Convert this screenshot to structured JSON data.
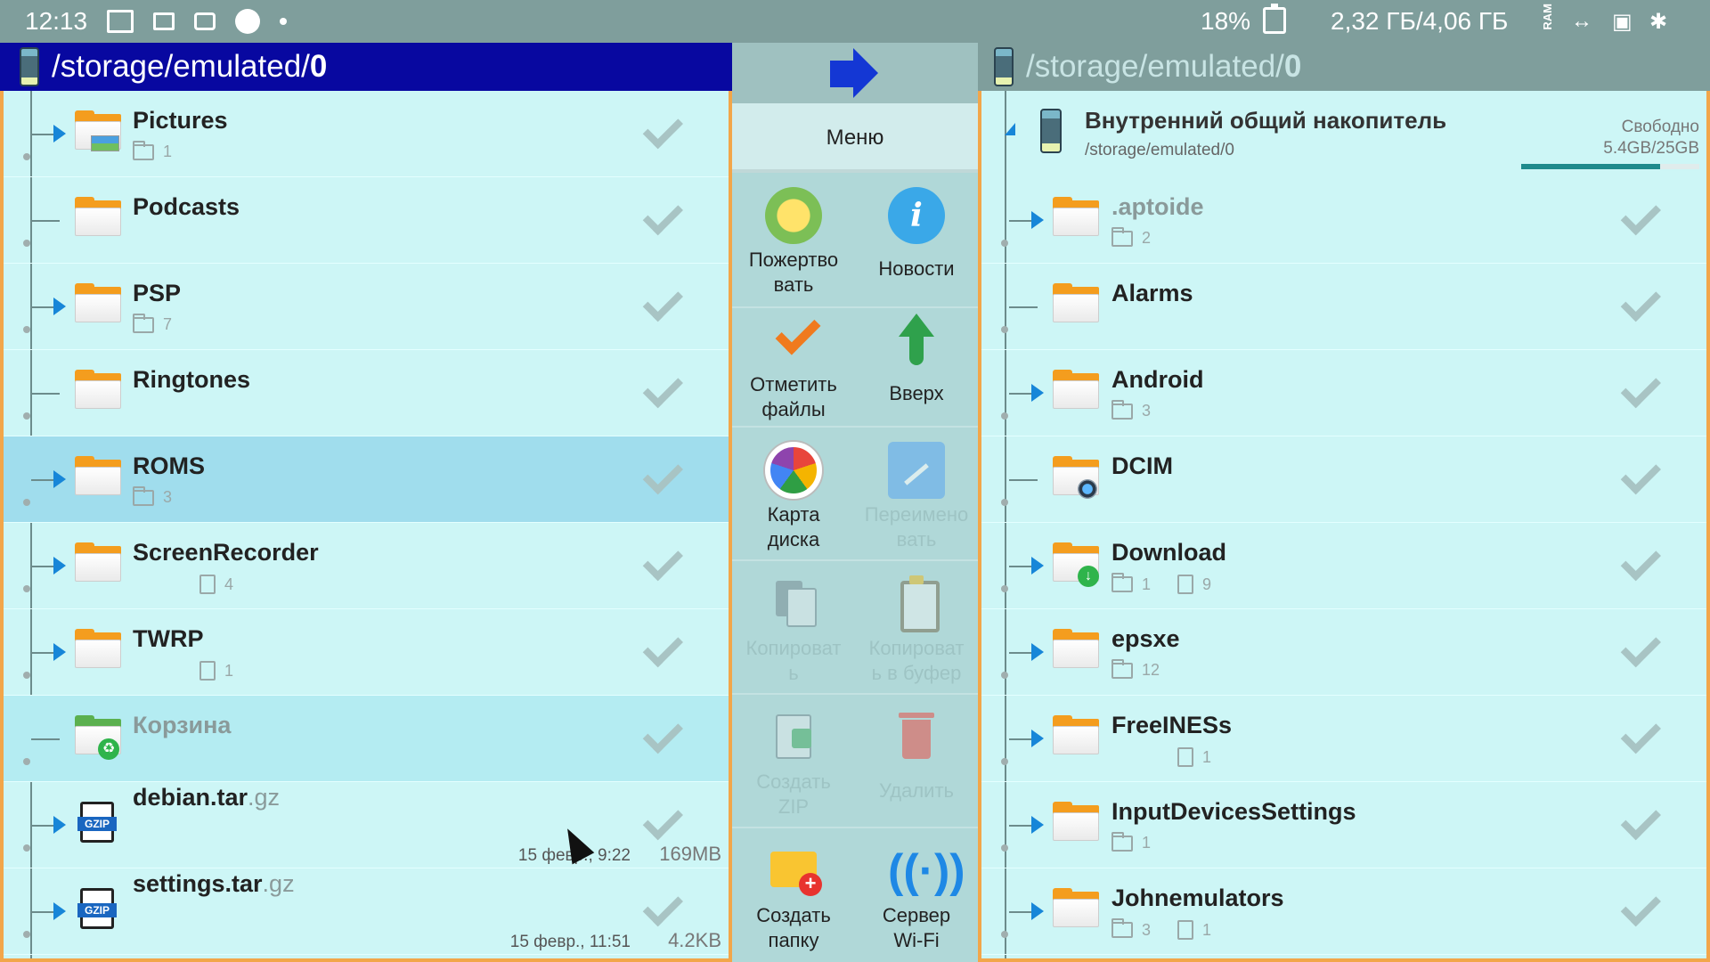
{
  "status_bar": {
    "time": "12:13",
    "battery": "18%",
    "ram": "2,32 ГБ/4,06 ГБ",
    "ram_label": "RAM"
  },
  "left_panel": {
    "path_prefix": "/storage/emulated/",
    "path_last": "0",
    "rows": [
      {
        "name": "Pictures",
        "folders": "1",
        "expandable": true,
        "icon": "folder-pictures-icon"
      },
      {
        "name": "Podcasts",
        "expandable": false,
        "icon": "folder-icon"
      },
      {
        "name": "PSP",
        "folders": "7",
        "expandable": true,
        "icon": "folder-icon"
      },
      {
        "name": "Ringtones",
        "expandable": false,
        "icon": "folder-icon"
      },
      {
        "name": "ROMS",
        "folders": "3",
        "expandable": true,
        "icon": "folder-icon",
        "selected": true
      },
      {
        "name": "ScreenRecorder",
        "files": "4",
        "expandable": true,
        "icon": "folder-icon"
      },
      {
        "name": "TWRP",
        "files": "1",
        "expandable": true,
        "icon": "folder-icon"
      },
      {
        "name": "Корзина",
        "expandable": false,
        "icon": "recycle-bin-icon",
        "dim": true
      },
      {
        "name": "debian.tar",
        "ext": ".gz",
        "date": "15 февр., 9:22",
        "size": "169MB",
        "icon": "gzip-file-icon"
      },
      {
        "name": "settings.tar",
        "ext": ".gz",
        "date": "15 февр., 11:51",
        "size": "4.2KB",
        "icon": "gzip-file-icon"
      }
    ]
  },
  "menu": {
    "title": "Меню",
    "buttons": [
      {
        "label1": "Пожертво",
        "label2": "вать",
        "icon": "beer-icon"
      },
      {
        "label1": "Новости",
        "label2": "",
        "icon": "info-icon",
        "glyph": "i"
      },
      {
        "label1": "Отметить",
        "label2": "файлы",
        "icon": "check-icon"
      },
      {
        "label1": "Вверх",
        "label2": "",
        "icon": "up-arrow-icon"
      },
      {
        "label1": "Карта",
        "label2": "диска",
        "icon": "disk-map-icon"
      },
      {
        "label1": "Переимено",
        "label2": "вать",
        "icon": "rename-icon"
      },
      {
        "label1": "Копироват",
        "label2": "ь",
        "icon": "copy-icon"
      },
      {
        "label1": "Копироват",
        "label2": "ь в буфер",
        "icon": "clipboard-icon"
      },
      {
        "label1": "Создать",
        "label2": "ZIP",
        "icon": "zip-icon"
      },
      {
        "label1": "Удалить",
        "label2": "",
        "icon": "trash-icon"
      },
      {
        "label1": "Создать",
        "label2": "папку",
        "icon": "new-folder-icon"
      },
      {
        "label1": "Сервер",
        "label2": "Wi-Fi",
        "icon": "wifi-icon",
        "glyph": "((·))"
      }
    ]
  },
  "right_panel": {
    "path_prefix": "/storage/emulated/",
    "path_last": "0",
    "storage": {
      "title": "Внутренний общий накопитель",
      "path": "/storage/emulated/0",
      "free_label": "Свободно",
      "free_value": "5.4GB/25GB",
      "used_fraction": 0.78
    },
    "rows": [
      {
        "name": ".aptoide",
        "folders": "2",
        "dim": true
      },
      {
        "name": "Alarms"
      },
      {
        "name": "Android",
        "folders": "3"
      },
      {
        "name": "DCIM",
        "icon": "folder-camera-icon"
      },
      {
        "name": "Download",
        "folders": "1",
        "files": "9",
        "icon": "folder-download-icon"
      },
      {
        "name": "epsxe",
        "folders": "12"
      },
      {
        "name": "FreeINESs",
        "files": "1"
      },
      {
        "name": "InputDevicesSettings",
        "folders": "1"
      },
      {
        "name": "Johnemulators",
        "folders": "3",
        "files": "1"
      }
    ]
  }
}
